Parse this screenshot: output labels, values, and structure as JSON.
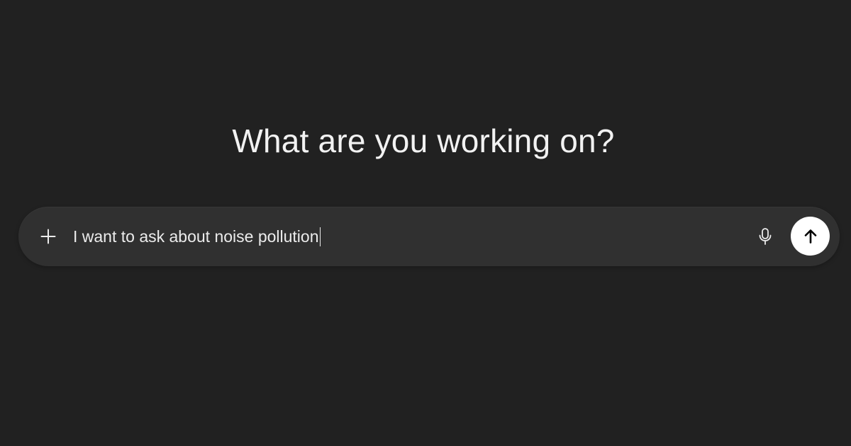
{
  "main": {
    "heading": "What are you working on?"
  },
  "composer": {
    "input_value": "I want to ask about noise pollution",
    "attach_icon": "plus-icon",
    "voice_icon": "microphone-icon",
    "send_icon": "arrow-up-icon"
  },
  "colors": {
    "background": "#212121",
    "composer_background": "#303030",
    "text": "#ececec",
    "send_button": "#ffffff",
    "send_icon": "#000000"
  }
}
